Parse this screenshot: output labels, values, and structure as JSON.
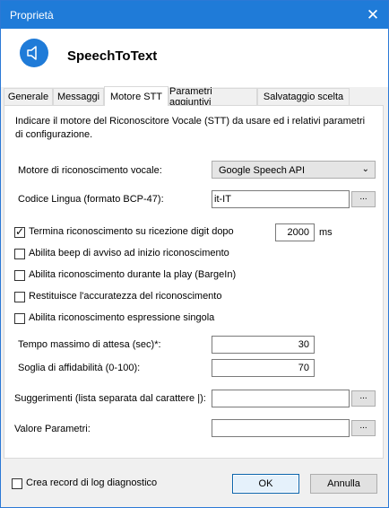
{
  "window": {
    "title": "Proprietà"
  },
  "header": {
    "app_name": "SpeechToText",
    "icon": "speaker-icon"
  },
  "tabs": [
    {
      "label": "Generale",
      "active": false
    },
    {
      "label": "Messaggi",
      "active": false
    },
    {
      "label": "Motore STT",
      "active": true
    },
    {
      "label": "Parametri aggiuntivi",
      "active": false
    },
    {
      "label": "Salvataggio scelta",
      "active": false
    }
  ],
  "panel": {
    "description": "Indicare il motore del Riconoscitore Vocale (STT) da usare ed i relativi parametri di configurazione.",
    "engine": {
      "label": "Motore di riconoscimento vocale:",
      "value": "Google Speech API"
    },
    "language": {
      "label": "Codice Lingua (formato BCP-47):",
      "value": "it-IT",
      "browse": "..."
    },
    "digit": {
      "label": "Termina riconoscimento su ricezione digit dopo",
      "value": "2000",
      "unit": "ms",
      "checked": true
    },
    "checkboxes": [
      {
        "label": "Abilita beep di avviso ad inizio riconoscimento",
        "checked": false
      },
      {
        "label": "Abilita riconoscimento durante la play (BargeIn)",
        "checked": false
      },
      {
        "label": "Restituisce l'accuratezza del riconoscimento",
        "checked": false
      },
      {
        "label": "Abilita riconoscimento espressione singola",
        "checked": false
      }
    ],
    "max_wait": {
      "label": "Tempo massimo di attesa (sec)*:",
      "value": "30"
    },
    "threshold": {
      "label": "Soglia di affidabilità (0-100):",
      "value": "70"
    },
    "suggestions": {
      "label": "Suggerimenti (lista separata dal carattere |):",
      "value": "",
      "browse": "..."
    },
    "param_value": {
      "label": "Valore Parametri:",
      "value": "",
      "browse": "..."
    }
  },
  "footer": {
    "log": {
      "label": "Crea record di log diagnostico",
      "checked": false
    },
    "ok": "OK",
    "cancel": "Annulla"
  },
  "colors": {
    "titlebar": "#1f7bd8",
    "accent": "#0a64ad"
  }
}
